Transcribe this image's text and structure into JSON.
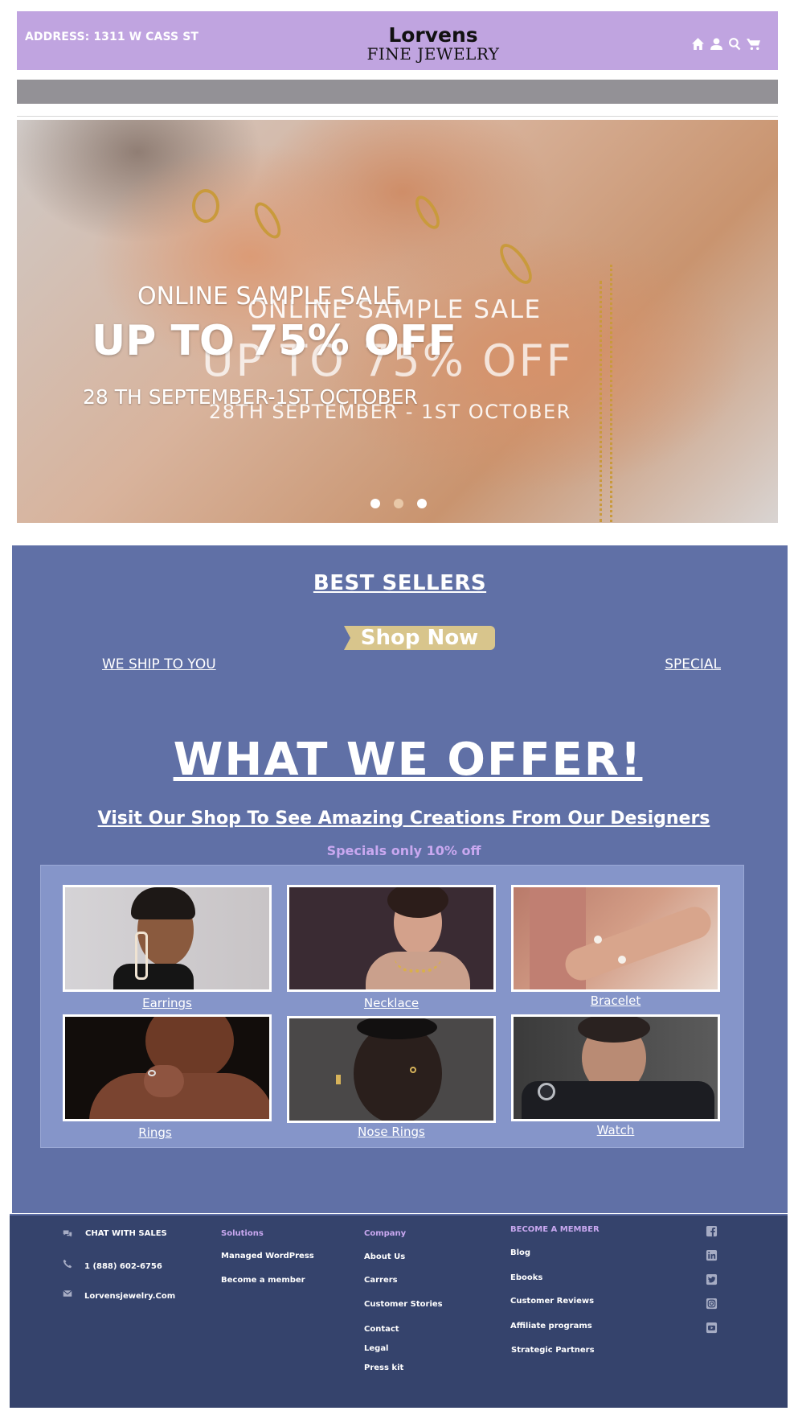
{
  "header": {
    "address": "ADDRESS: 1311 W CASS ST",
    "logo_name": "Lorvens",
    "logo_sub": "FINE JEWELRY",
    "icons": [
      "home-icon",
      "user-icon",
      "search-icon",
      "cart-icon"
    ]
  },
  "hero": {
    "layer1": {
      "line1": "ONLINE SAMPLE SALE",
      "line2": "UP TO 75% OFF",
      "line3": "28 TH SEPTEMBER-1ST OCTOBER"
    },
    "layer2": {
      "line1": "ONLINE SAMPLE SALE",
      "line2": "UP TO 75% OFF",
      "line3": "28TH SEPTEMBER - 1ST OCTOBER"
    },
    "slides": 3,
    "active_slide": 2
  },
  "main": {
    "best_sellers": "BEST SELLERS",
    "shop_now": "Shop Now",
    "ship": "WE SHIP TO YOU",
    "special": "SPECIAL",
    "offer_title": "WHAT WE OFFER!",
    "visit": "Visit Our Shop To See Amazing Creations From Our Designers",
    "specials_note": "Specials only 10% off",
    "products": [
      {
        "label": "Earrings"
      },
      {
        "label": "Necklace"
      },
      {
        "label": "Bracelet"
      },
      {
        "label": "Rings"
      },
      {
        "label": "Nose Rings"
      },
      {
        "label": "Watch"
      }
    ]
  },
  "footer": {
    "contact": {
      "chat": "CHAT WITH SALES",
      "phone": "1 (888) 602-6756",
      "email": "Lorvensjewelry.Com"
    },
    "solutions": {
      "title": "Solutions",
      "items": [
        "Managed WordPress",
        "Become a member"
      ]
    },
    "company": {
      "title": "Company",
      "items": [
        "About Us",
        "Carrers",
        "Customer Stories",
        "Contact",
        "Legal",
        "Press kit"
      ]
    },
    "member": {
      "title": "BECOME A MEMBER",
      "items": [
        "Blog",
        "Ebooks",
        "Customer Reviews",
        "Affiliate programs",
        "Strategic Partners"
      ]
    },
    "social": [
      "facebook-icon",
      "linkedin-icon",
      "twitter-icon",
      "instagram-icon",
      "youtube-icon"
    ],
    "colors": {
      "accent": "#c9a8f0",
      "background": "#35436c"
    }
  },
  "colors": {
    "header_bg": "#c0a4e0",
    "main_bg": "#6070a6",
    "grid_bg": "#8595c9",
    "button": "#d8c58c"
  }
}
